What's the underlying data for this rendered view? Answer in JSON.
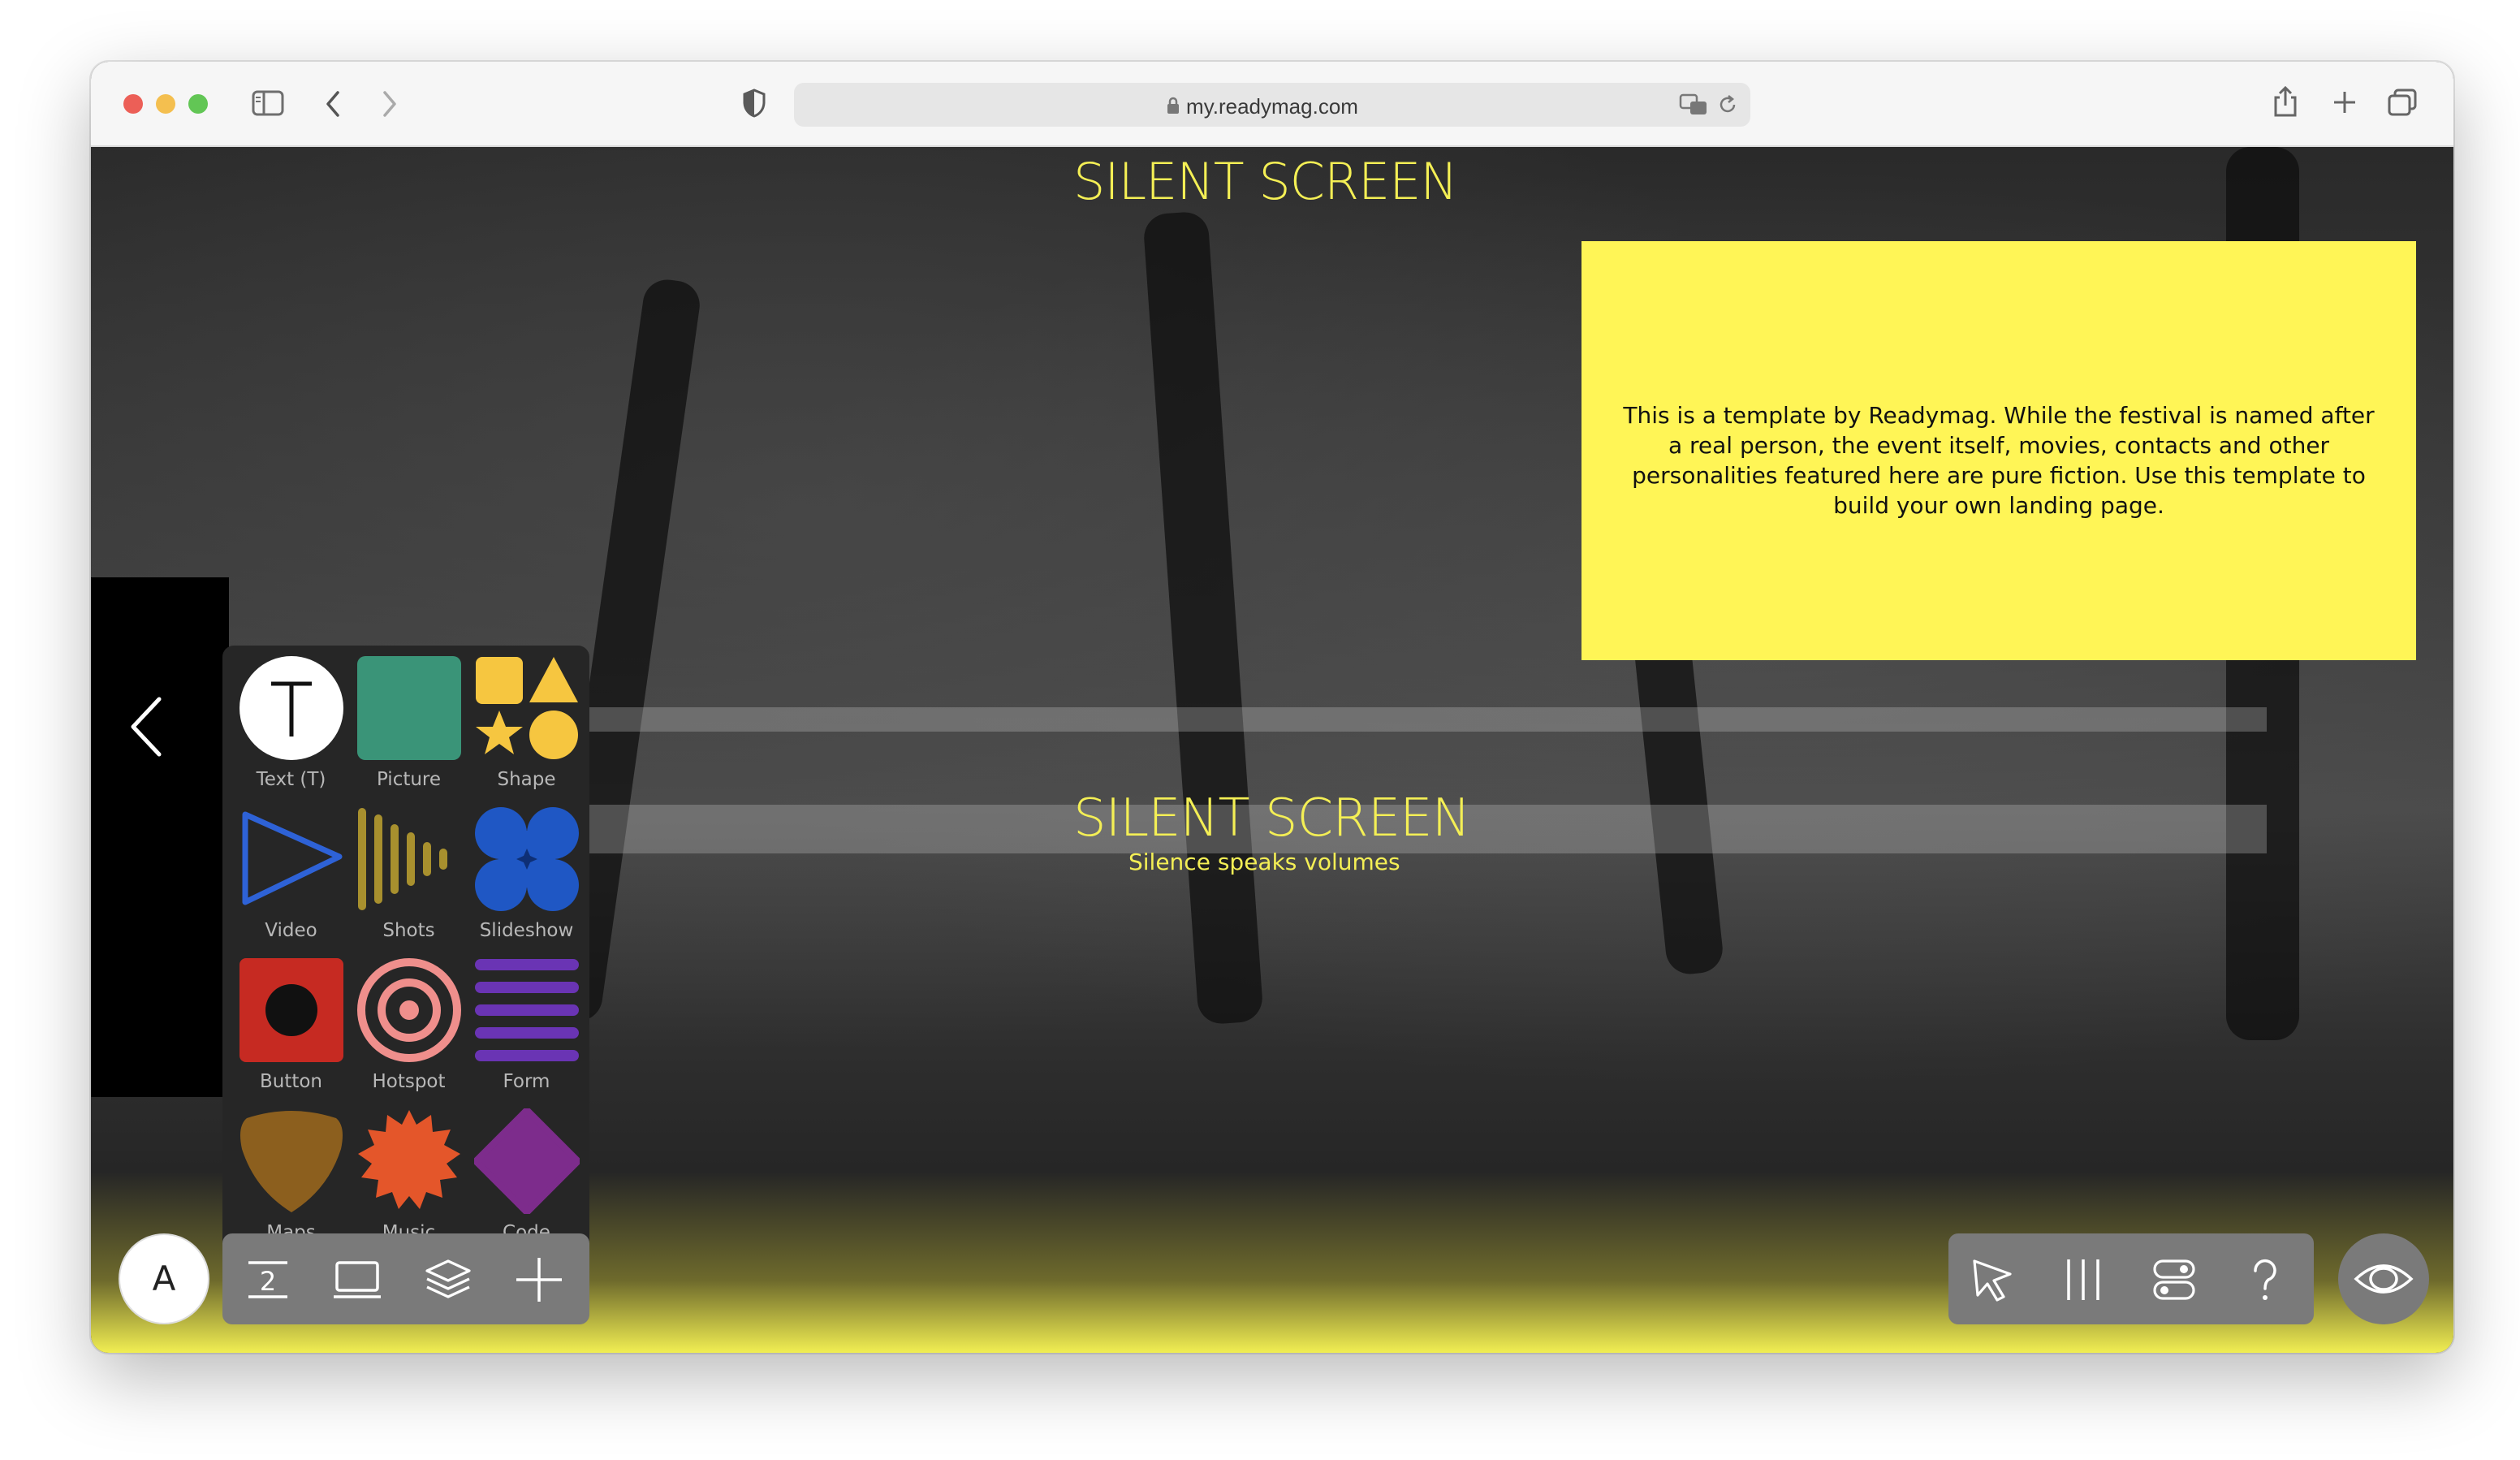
{
  "browser": {
    "url": "my.readymag.com"
  },
  "page": {
    "top_title": "SILENT SCREEN",
    "hero_title": "SILENT SCREEN",
    "hero_subtitle": "Silence speaks volumes",
    "info_text": "This is a template by Readymag. While the festival is named after a real person, the event itself, movies, contacts and other personalities featured here are pure fiction. Use this template to build your own landing page.",
    "accent_color": "#f4ef55"
  },
  "widgets": [
    {
      "label": "Text (T)",
      "icon": "text-icon"
    },
    {
      "label": "Picture",
      "icon": "picture-icon"
    },
    {
      "label": "Shape",
      "icon": "shape-icon"
    },
    {
      "label": "Video",
      "icon": "video-icon"
    },
    {
      "label": "Shots",
      "icon": "shots-icon"
    },
    {
      "label": "Slideshow",
      "icon": "slideshow-icon"
    },
    {
      "label": "Button",
      "icon": "button-icon"
    },
    {
      "label": "Hotspot",
      "icon": "hotspot-icon"
    },
    {
      "label": "Form",
      "icon": "form-icon"
    },
    {
      "label": "Maps",
      "icon": "maps-icon"
    },
    {
      "label": "Music",
      "icon": "music-icon"
    },
    {
      "label": "Code",
      "icon": "code-icon"
    }
  ],
  "toolbar": {
    "avatar_letter": "A",
    "page_number": "2"
  }
}
